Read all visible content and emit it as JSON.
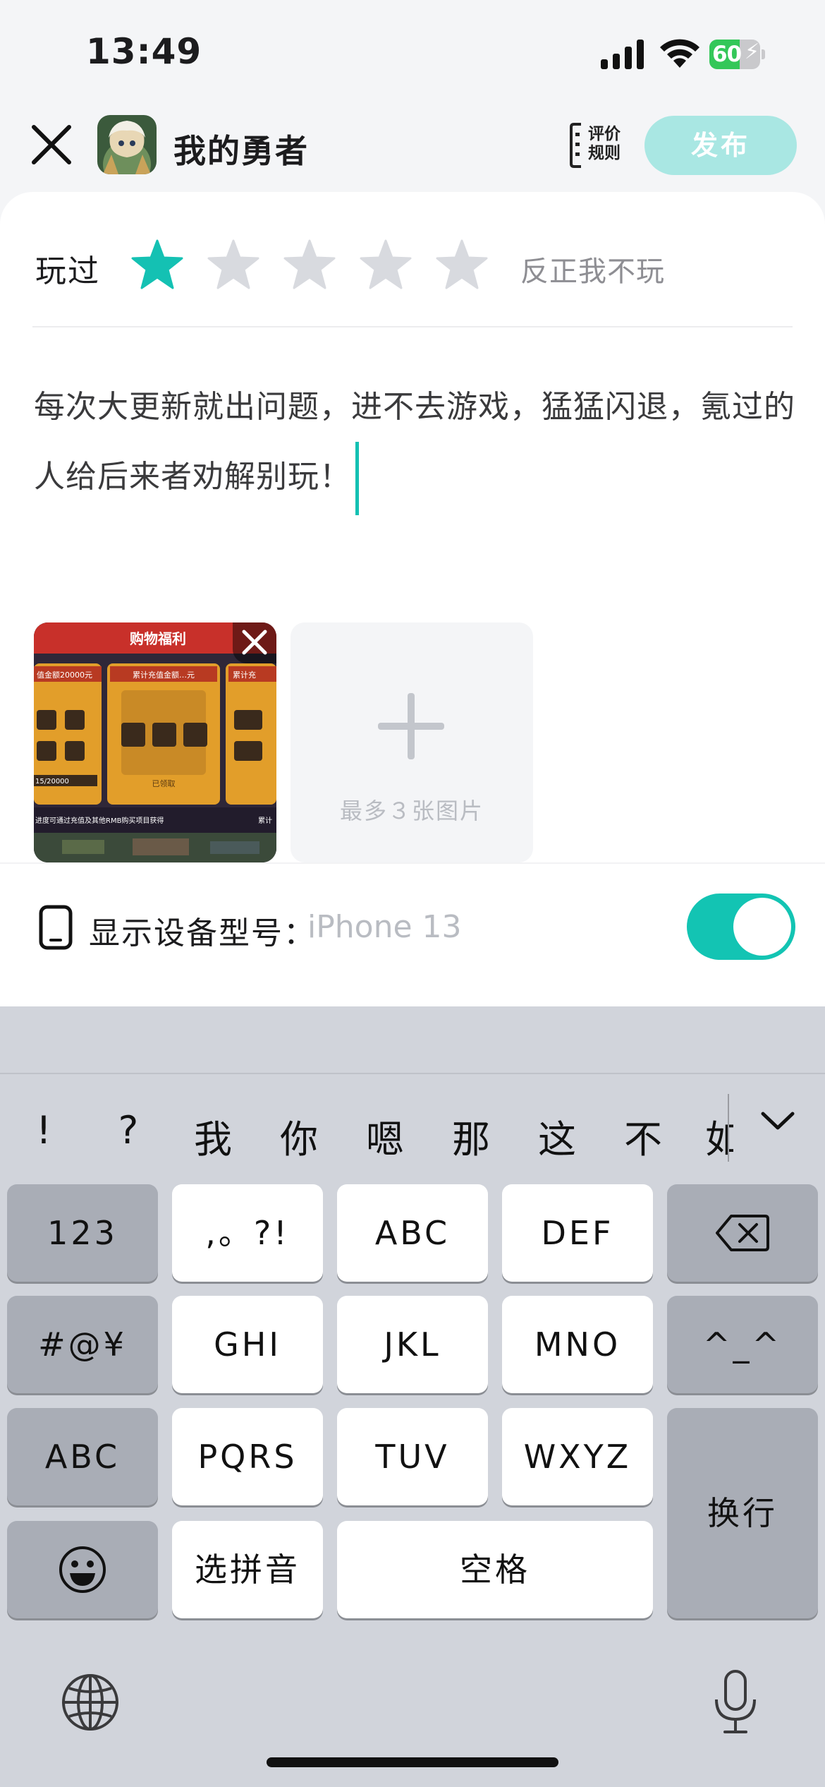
{
  "status_bar": {
    "time": "13:49",
    "battery": "60",
    "battery_level_percent": 60
  },
  "header": {
    "app_title": "我的勇者",
    "rules_label": "评价规则",
    "publish_label": "发布"
  },
  "rating": {
    "label": "玩过",
    "stars_total": 5,
    "stars_selected": 1,
    "selected_text": "反正我不玩",
    "star_color": "#14c1b3"
  },
  "review": {
    "text": "每次大更新就出问题，进不去游戏，猛猛闪退，氪过的人给后来者劝解别玩！"
  },
  "images": {
    "thumb_title": "购物福利",
    "thumb_cards": [
      "值金额20000元",
      "累计充值金额…元",
      "累计充"
    ],
    "thumb_claimed": "已领取",
    "thumb_progress": "15/20000",
    "thumb_footer": "进度可通过充值及其他RMB购买项目获得",
    "thumb_footer_right": "累计",
    "add_hint": "最多３张图片"
  },
  "device": {
    "label": "显示设备型号：",
    "value": "iPhone 13",
    "toggle_on": true
  },
  "keyboard": {
    "candidates": [
      "!",
      "?",
      "我",
      "你",
      "嗯",
      "那",
      "这",
      "不",
      "如"
    ],
    "rows": [
      [
        "123",
        ",。?!",
        "ABC",
        "DEF"
      ],
      [
        "#@¥",
        "GHI",
        "JKL",
        "MNO",
        "^_^"
      ],
      [
        "ABC",
        "PQRS",
        "TUV",
        "WXYZ",
        "换行"
      ],
      [
        "选拼音",
        "空格"
      ]
    ]
  },
  "colors": {
    "accent": "#14c1b3",
    "publish_disabled": "#a9e7e3",
    "keyboard_bg": "#d1d4db"
  }
}
